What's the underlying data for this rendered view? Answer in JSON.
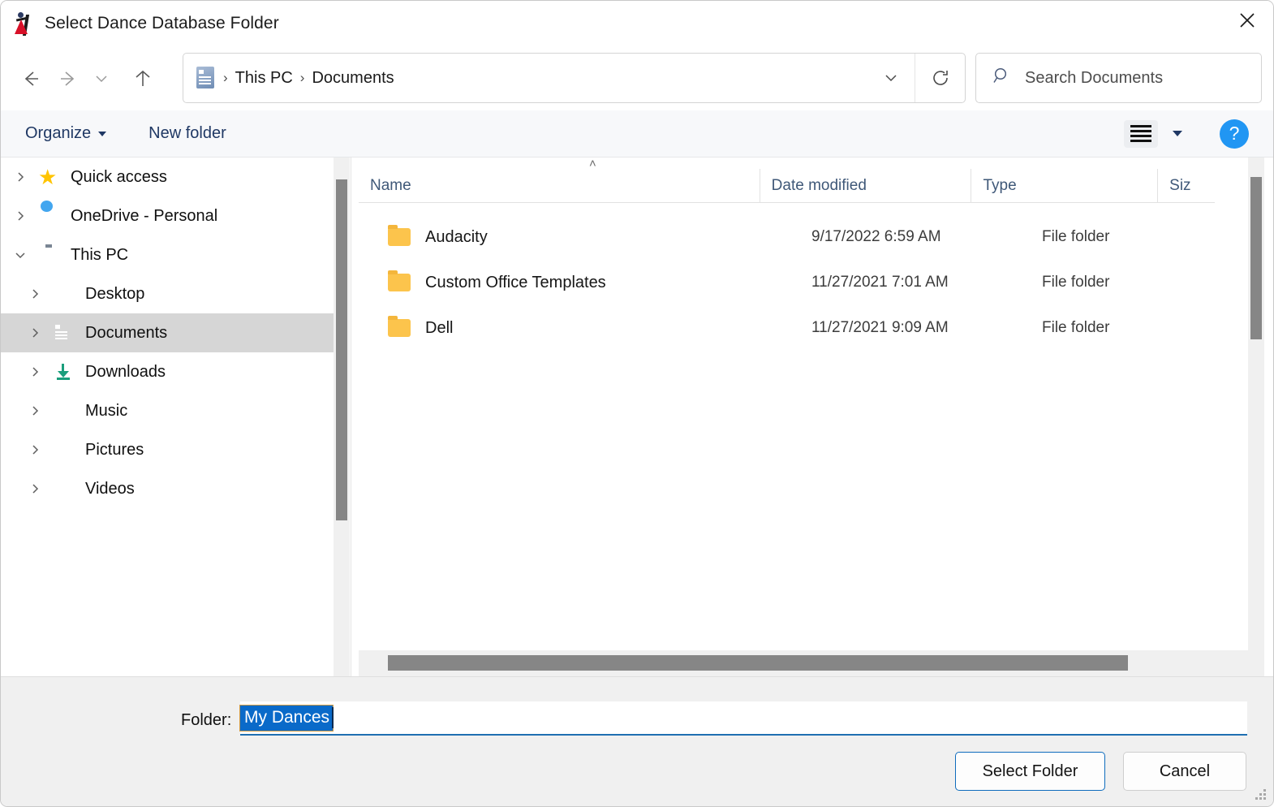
{
  "window": {
    "title": "Select Dance Database Folder",
    "app_icon": "dancer-icon",
    "close_label": "✕"
  },
  "nav": {
    "back_icon": "arrow-left-icon",
    "forward_icon": "arrow-right-icon",
    "recent_icon": "chevron-down-icon",
    "up_icon": "arrow-up-icon",
    "breadcrumb_icon": "documents-folder-icon",
    "breadcrumb": [
      "This PC",
      "Documents"
    ],
    "separator": "›",
    "dropdown_icon": "chevron-down-icon",
    "refresh_icon": "refresh-icon"
  },
  "search": {
    "icon": "search-icon",
    "placeholder": "Search Documents",
    "value": ""
  },
  "commandbar": {
    "organize_label": "Organize",
    "new_folder_label": "New folder",
    "view_icon": "list-view-icon",
    "view_caret_icon": "chevron-down-icon",
    "help_label": "?"
  },
  "sidebar": {
    "items": [
      {
        "label": "Quick access",
        "icon": "star-icon",
        "expanded": false,
        "selected": false,
        "indent": 0
      },
      {
        "label": "OneDrive - Personal",
        "icon": "cloud-icon",
        "expanded": false,
        "selected": false,
        "indent": 0
      },
      {
        "label": "This PC",
        "icon": "monitor-icon",
        "expanded": true,
        "selected": false,
        "indent": 0
      },
      {
        "label": "Desktop",
        "icon": "desktop-icon",
        "expanded": false,
        "selected": false,
        "indent": 1
      },
      {
        "label": "Documents",
        "icon": "documents-icon",
        "expanded": false,
        "selected": true,
        "indent": 1
      },
      {
        "label": "Downloads",
        "icon": "download-icon",
        "expanded": false,
        "selected": false,
        "indent": 1
      },
      {
        "label": "Music",
        "icon": "music-icon",
        "expanded": false,
        "selected": false,
        "indent": 1
      },
      {
        "label": "Pictures",
        "icon": "pictures-icon",
        "expanded": false,
        "selected": false,
        "indent": 1
      },
      {
        "label": "Videos",
        "icon": "videos-icon",
        "expanded": false,
        "selected": false,
        "indent": 1
      }
    ]
  },
  "filelist": {
    "sort_indicator": "˄",
    "columns": [
      "Name",
      "Date modified",
      "Type",
      "Siz"
    ],
    "rows": [
      {
        "name": "Audacity",
        "date": "9/17/2022 6:59 AM",
        "type": "File folder",
        "icon": "folder-icon"
      },
      {
        "name": "Custom Office Templates",
        "date": "11/27/2021 7:01 AM",
        "type": "File folder",
        "icon": "folder-icon"
      },
      {
        "name": "Dell",
        "date": "11/27/2021 9:09 AM",
        "type": "File folder",
        "icon": "folder-icon"
      }
    ]
  },
  "bottom": {
    "folder_label": "Folder:",
    "folder_value": "My Dances",
    "select_button": "Select Folder",
    "cancel_button": "Cancel"
  },
  "colors": {
    "accent": "#0a6ac9",
    "default_button_border": "#0f6cbd",
    "help_blue": "#2196f3",
    "selection_gray": "#d6d6d6",
    "scrollbar_thumb": "#868686"
  }
}
